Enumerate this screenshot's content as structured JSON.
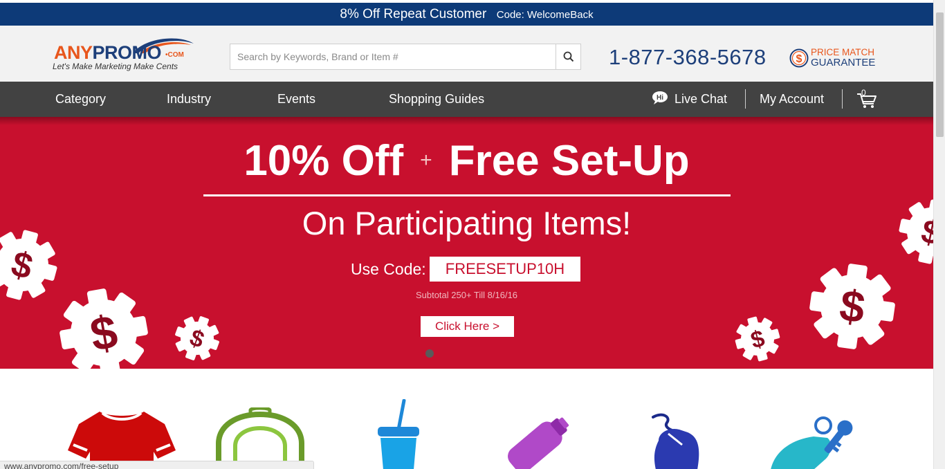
{
  "promo_bar": {
    "message": "8% Off Repeat Customer",
    "code": "Code: WelcomeBack"
  },
  "header": {
    "logo": {
      "word_any": "ANY",
      "word_promo": "PROMO",
      "word_com": "•COM",
      "tagline": "Let's Make Marketing Make Cents"
    },
    "search": {
      "placeholder": "Search by Keywords, Brand or Item #",
      "value": ""
    },
    "phone": "1-877-368-5678",
    "price_match": {
      "line1": "PRICE MATCH",
      "line2": "GUARANTEE"
    }
  },
  "nav": {
    "items": [
      {
        "label": "Category"
      },
      {
        "label": "Industry"
      },
      {
        "label": "Events"
      },
      {
        "label": "Shopping Guides"
      }
    ],
    "live_chat": "Live Chat",
    "my_account": "My Account",
    "cart_count": "0"
  },
  "hero": {
    "headline_left": "10% Off",
    "plus": "+",
    "headline_right": "Free Set-Up",
    "subheadline": "On Participating Items!",
    "code_label": "Use Code:",
    "code": "FREESETUP10H",
    "terms": "Subtotal 250+  Till 8/16/16",
    "cta": "Click Here >"
  },
  "products": [
    {
      "icon": "t-shirt-icon"
    },
    {
      "icon": "backpack-icon"
    },
    {
      "icon": "cup-with-straw-icon"
    },
    {
      "icon": "water-bottle-icon"
    },
    {
      "icon": "computer-mouse-icon"
    },
    {
      "icon": "keychain-icon"
    }
  ],
  "status_bar": {
    "url": "www.anypromo.com/free-setup"
  },
  "colors": {
    "promo_bar": "#0d3a78",
    "brand_orange": "#e8561c",
    "brand_navy": "#1d3f7a",
    "nav_bg": "#424242",
    "hero_red": "#c8102e"
  }
}
